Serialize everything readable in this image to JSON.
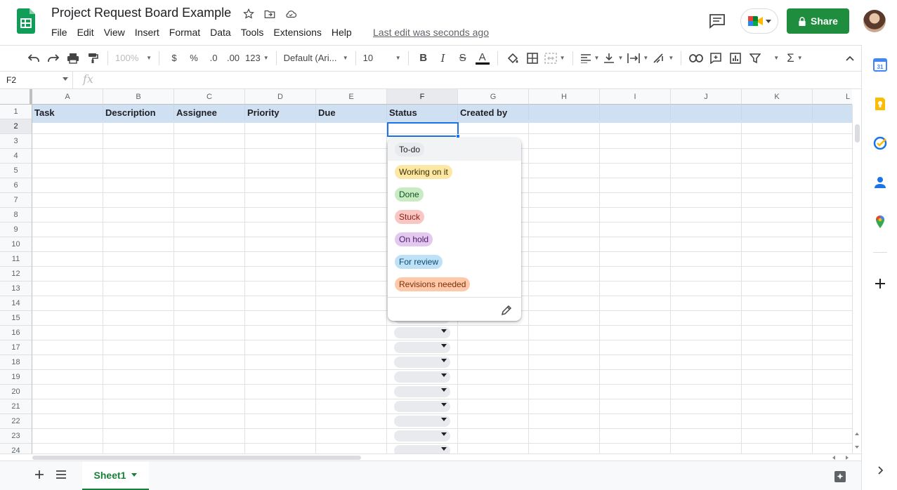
{
  "doc": {
    "title": "Project Request Board Example",
    "last_edit": "Last edit was seconds ago"
  },
  "menu": [
    "File",
    "Edit",
    "View",
    "Insert",
    "Format",
    "Data",
    "Tools",
    "Extensions",
    "Help"
  ],
  "share": {
    "label": "Share"
  },
  "toolbar": {
    "zoom": "100%",
    "currency": "$",
    "percent": "%",
    "dec_less": ".0",
    "dec_more": ".00",
    "format_more": "123",
    "font": "Default (Ari...",
    "size": "10",
    "bold": "B",
    "italic": "I",
    "strike": "S",
    "text_color": "A"
  },
  "formula_bar": {
    "cell_ref": "F2",
    "fx": "fx"
  },
  "columns": [
    "A",
    "B",
    "C",
    "D",
    "E",
    "F",
    "G",
    "H",
    "I",
    "J",
    "K",
    "L"
  ],
  "selected_column": "F",
  "rows": [
    "1",
    "2",
    "3",
    "4",
    "5",
    "6",
    "7",
    "8",
    "9",
    "10",
    "11",
    "12",
    "13",
    "14",
    "15",
    "16",
    "17",
    "18",
    "19",
    "20",
    "21",
    "22",
    "23",
    "24"
  ],
  "header_row": [
    "Task",
    "Description",
    "Assignee",
    "Priority",
    "Due",
    "Status",
    "Created by"
  ],
  "dropdown": {
    "options": [
      {
        "label": "To-do",
        "color": "#e8eaed",
        "text": "#202124"
      },
      {
        "label": "Working on it",
        "color": "#fce8a4",
        "text": "#3c2f00"
      },
      {
        "label": "Done",
        "color": "#c8ebc2",
        "text": "#0d5223"
      },
      {
        "label": "Stuck",
        "color": "#f8c6c3",
        "text": "#8a1c14"
      },
      {
        "label": "On hold",
        "color": "#e3c8ef",
        "text": "#4a1d6b"
      },
      {
        "label": "For review",
        "color": "#bfe1f6",
        "text": "#0b4a74"
      },
      {
        "label": "Revisions needed",
        "color": "#ffc8a8",
        "text": "#7a2e06"
      }
    ]
  },
  "sheet_tab": {
    "label": "Sheet1"
  },
  "colors": {
    "accent_green": "#1e8e3e",
    "selection_blue": "#1a73e8",
    "header_fill": "#cfe0f3"
  }
}
